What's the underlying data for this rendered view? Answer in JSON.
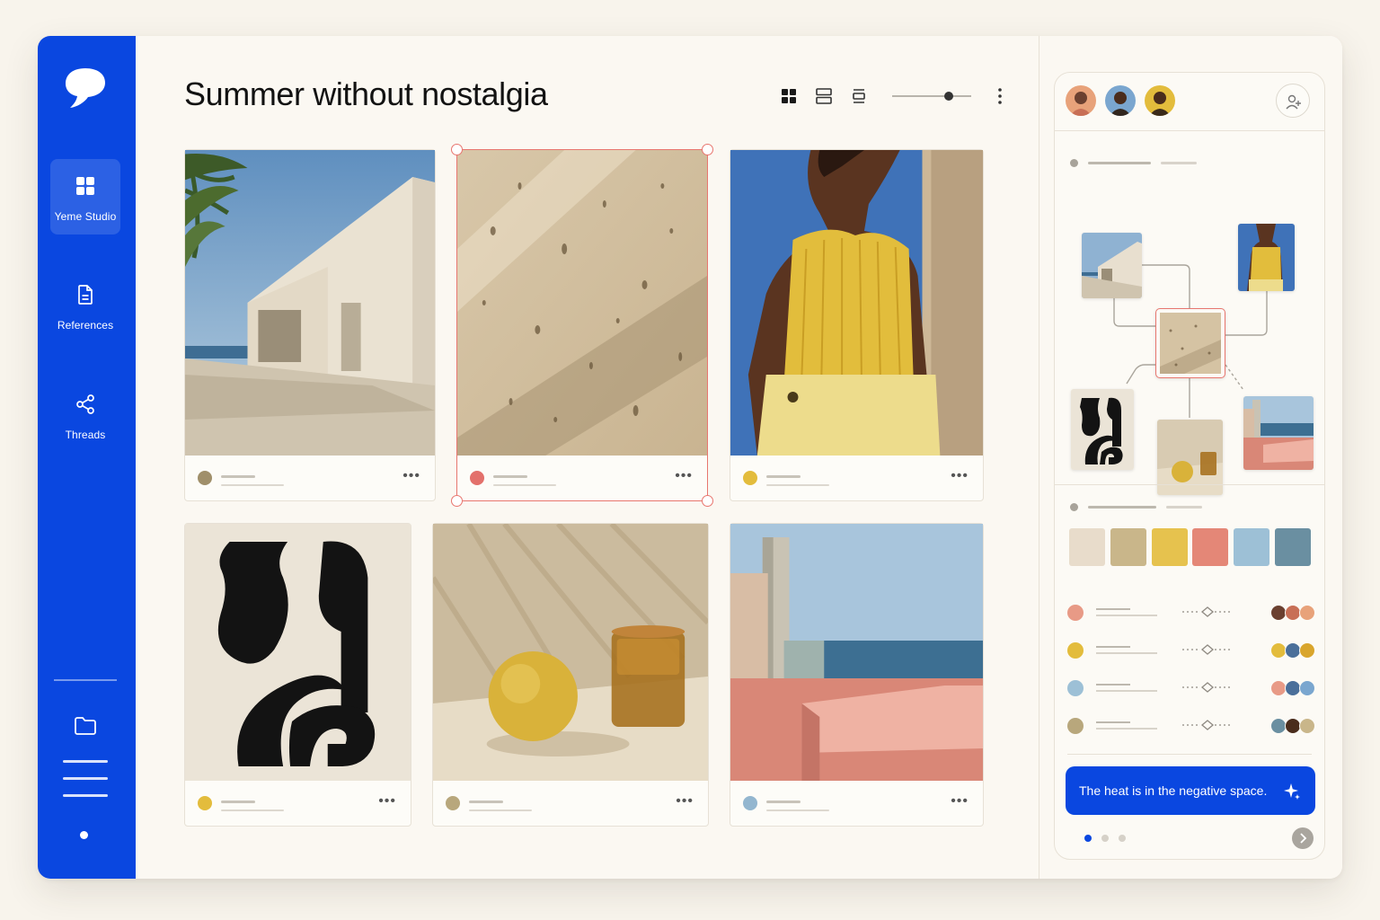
{
  "sidebar": {
    "items": [
      {
        "label": "Yeme Studio",
        "icon": "grid-icon",
        "active": true
      },
      {
        "label": "References",
        "icon": "document-icon",
        "active": false
      },
      {
        "label": "Threads",
        "icon": "share-icon",
        "active": false
      }
    ],
    "bottom_icons": [
      "folder-icon",
      "menu-icon"
    ]
  },
  "main": {
    "title": "Summer without nostalgia",
    "toolbar": {
      "views": [
        "grid-view-icon",
        "rows-view-icon",
        "compact-view-icon"
      ],
      "zoom_level": 0.7
    },
    "cards": [
      {
        "image": "white-architecture-palm",
        "color": "#a08f6a",
        "selected": false
      },
      {
        "image": "travertine-texture",
        "color": "#e3706b",
        "selected": true
      },
      {
        "image": "woman-yellow-top",
        "color": "#e3bc3c",
        "selected": false
      },
      {
        "image": "black-abstract-shapes",
        "color": "#e3bc3c",
        "selected": false
      },
      {
        "image": "lemon-and-amber-glass",
        "color": "#b8a77c",
        "selected": false
      },
      {
        "image": "pink-coastal-building",
        "color": "#93b6cf",
        "selected": false
      }
    ],
    "more_label": "•••"
  },
  "panel": {
    "collaborators": [
      "avatar-1",
      "avatar-2",
      "avatar-3"
    ],
    "palette": [
      "#e8dccb",
      "#c9b68a",
      "#e6c24e",
      "#e48777",
      "#9dc0d6",
      "#6a8fa1"
    ],
    "threads": [
      {
        "color": "#e89a86"
      },
      {
        "color": "#e3bc3c"
      },
      {
        "color": "#9dc0d6"
      },
      {
        "color": "#b8a77c"
      }
    ],
    "cta_text": "The heat is in the negative space.",
    "pager": {
      "count": 3,
      "active": 0
    }
  }
}
